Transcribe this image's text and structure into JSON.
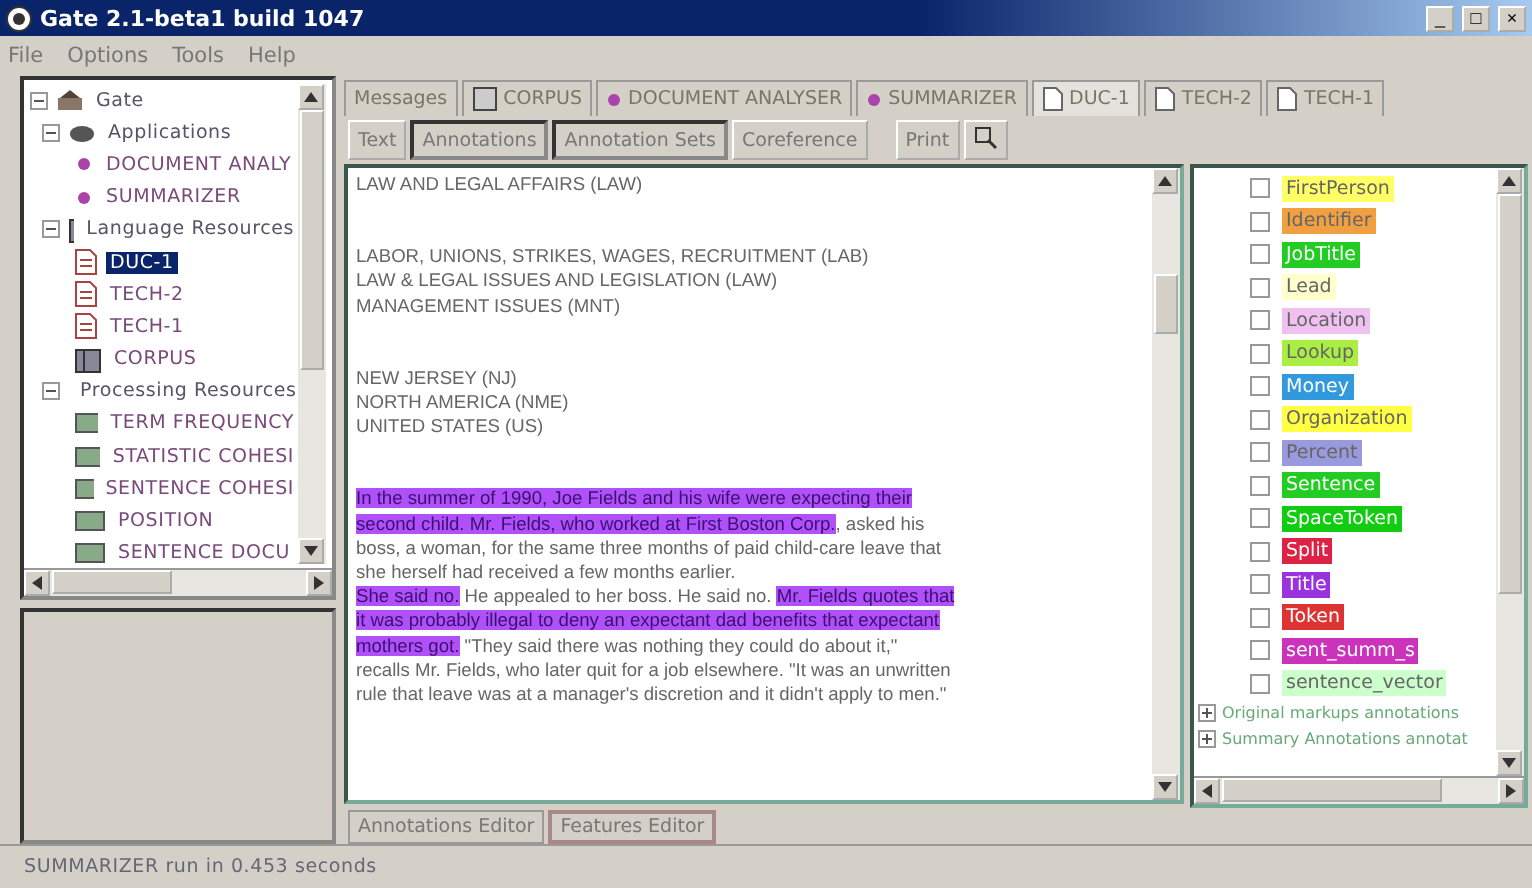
{
  "window": {
    "title": "Gate 2.1-beta1 build 1047",
    "controls": [
      "_",
      "□",
      "×"
    ]
  },
  "menu": [
    "File",
    "Options",
    "Tools",
    "Help"
  ],
  "tree": {
    "label": "Gate",
    "kind": "root",
    "expanded": true,
    "children": [
      {
        "label": "Applications",
        "kind": "apps",
        "expanded": true,
        "children": [
          {
            "label": "DOCUMENT ANALY",
            "kind": "app",
            "selected": false
          },
          {
            "label": "SUMMARIZER",
            "kind": "app",
            "selected": false
          }
        ]
      },
      {
        "label": "Language Resources",
        "kind": "lr",
        "expanded": true,
        "children": [
          {
            "label": "DUC-1",
            "kind": "doc",
            "selected": true
          },
          {
            "label": "TECH-2",
            "kind": "doc",
            "selected": false
          },
          {
            "label": "TECH-1",
            "kind": "doc",
            "selected": false
          },
          {
            "label": "CORPUS",
            "kind": "corpus",
            "selected": false
          }
        ]
      },
      {
        "label": "Processing Resources",
        "kind": "pr",
        "expanded": true,
        "children": [
          {
            "label": "TERM FREQUENCY",
            "kind": "proc",
            "selected": false
          },
          {
            "label": "STATISTIC COHESI",
            "kind": "proc",
            "selected": false
          },
          {
            "label": "SENTENCE COHESI",
            "kind": "proc",
            "selected": false
          },
          {
            "label": "POSITION",
            "kind": "proc",
            "selected": false
          },
          {
            "label": "SENTENCE DOCU",
            "kind": "proc",
            "selected": false
          }
        ]
      }
    ]
  },
  "main_tabs": [
    {
      "label": "Messages",
      "kind": "plain",
      "selected": false
    },
    {
      "label": "CORPUS",
      "kind": "corpus",
      "selected": false
    },
    {
      "label": "DOCUMENT ANALYSER",
      "kind": "app",
      "selected": false
    },
    {
      "label": "SUMMARIZER",
      "kind": "app",
      "selected": false
    },
    {
      "label": "DUC-1",
      "kind": "doc",
      "selected": true
    },
    {
      "label": "TECH-2",
      "kind": "doc",
      "selected": false
    },
    {
      "label": "TECH-1",
      "kind": "doc",
      "selected": false
    }
  ],
  "view_buttons": [
    {
      "label": "Text",
      "kind": "toggle",
      "selected": false
    },
    {
      "label": "Annotations",
      "kind": "toggle",
      "selected": true
    },
    {
      "label": "Annotation Sets",
      "kind": "toggle",
      "selected": true
    },
    {
      "label": "Coreference",
      "kind": "toggle",
      "selected": false
    },
    {
      "label": "Print",
      "kind": "button",
      "selected": false
    },
    {
      "kind": "icon",
      "selected": false
    }
  ],
  "document": [
    {
      "paragraphs": [
        {
          "segments": [
            {
              "text": "LAW AND LEGAL AFFAIRS (LAW)",
              "highlighted": false
            }
          ]
        }
      ]
    },
    {
      "paragraphs": [
        {
          "segments": [
            {
              "text": "LABOR, UNIONS, STRIKES, WAGES, RECRUITMENT (LAB)",
              "highlighted": false
            }
          ]
        },
        {
          "segments": [
            {
              "text": "LAW & LEGAL ISSUES AND LEGISLATION (LAW)",
              "highlighted": false
            }
          ]
        },
        {
          "segments": [
            {
              "text": "MANAGEMENT ISSUES (MNT)",
              "highlighted": false
            }
          ]
        }
      ]
    },
    {
      "paragraphs": [
        {
          "segments": [
            {
              "text": "NEW JERSEY (NJ)",
              "highlighted": false
            }
          ]
        },
        {
          "segments": [
            {
              "text": "NORTH AMERICA (NME)",
              "highlighted": false
            }
          ]
        },
        {
          "segments": [
            {
              "text": "UNITED STATES (US)",
              "highlighted": false
            }
          ]
        }
      ]
    },
    {
      "paragraphs": [
        {
          "segments": [
            {
              "text": "In the summer of 1990, Joe Fields and his wife were expecting their second child. Mr. Fields, who worked at First Boston Corp.",
              "highlighted": true
            },
            {
              "text": ", asked his boss, a woman, for the same three months of paid child-care leave that she herself had received a few months earlier.",
              "highlighted": false
            }
          ]
        },
        {
          "segments": [
            {
              "text": "She said no.",
              "highlighted": true
            },
            {
              "text": " He appealed to her boss. He said no. ",
              "highlighted": false
            },
            {
              "text": "Mr. Fields quotes that it was probably illegal to deny an expectant dad benefits that expectant mothers got.",
              "highlighted": true
            },
            {
              "text": " \"They said there was nothing they could do about it,\" recalls Mr. Fields, who later quit for a job elsewhere. \"It was an unwritten rule that leave was at a manager's discretion and it didn't apply to men.\"",
              "highlighted": false
            }
          ]
        }
      ]
    }
  ],
  "annotations": [
    {
      "label": "FirstPerson",
      "checked": false,
      "color": "#ffff66"
    },
    {
      "label": "Identifier",
      "checked": false,
      "color": "#f0a040"
    },
    {
      "label": "JobTitle",
      "checked": false,
      "color": "#22cc22"
    },
    {
      "label": "Lead",
      "checked": false,
      "color": "#ffffcc"
    },
    {
      "label": "Location",
      "checked": false,
      "color": "#f0c0f0"
    },
    {
      "label": "Lookup",
      "checked": false,
      "color": "#aaee44"
    },
    {
      "label": "Money",
      "checked": false,
      "color": "#3399dd"
    },
    {
      "label": "Organization",
      "checked": false,
      "color": "#ffff44"
    },
    {
      "label": "Percent",
      "checked": false,
      "color": "#9999dd"
    },
    {
      "label": "Sentence",
      "checked": false,
      "color": "#22cc22"
    },
    {
      "label": "SpaceToken",
      "checked": false,
      "color": "#11cc11"
    },
    {
      "label": "Split",
      "checked": false,
      "color": "#dd2244"
    },
    {
      "label": "Title",
      "checked": false,
      "color": "#9933dd"
    },
    {
      "label": "Token",
      "checked": false,
      "color": "#dd3333"
    },
    {
      "label": "sent_summ_s",
      "checked": false,
      "color": "#cc33bb"
    },
    {
      "label": "sentence_vector",
      "checked": false,
      "color": "#ccffcc"
    }
  ],
  "annotation_sets": [
    {
      "label": "Original markups annotations",
      "expanded": false
    },
    {
      "label": "Summary Annotations annotat",
      "expanded": false
    }
  ],
  "editor_tabs": [
    {
      "label": "Annotations Editor",
      "selected": false
    },
    {
      "label": "Features Editor",
      "selected": true
    }
  ],
  "status_bar": "SUMMARIZER run in 0.453 seconds"
}
